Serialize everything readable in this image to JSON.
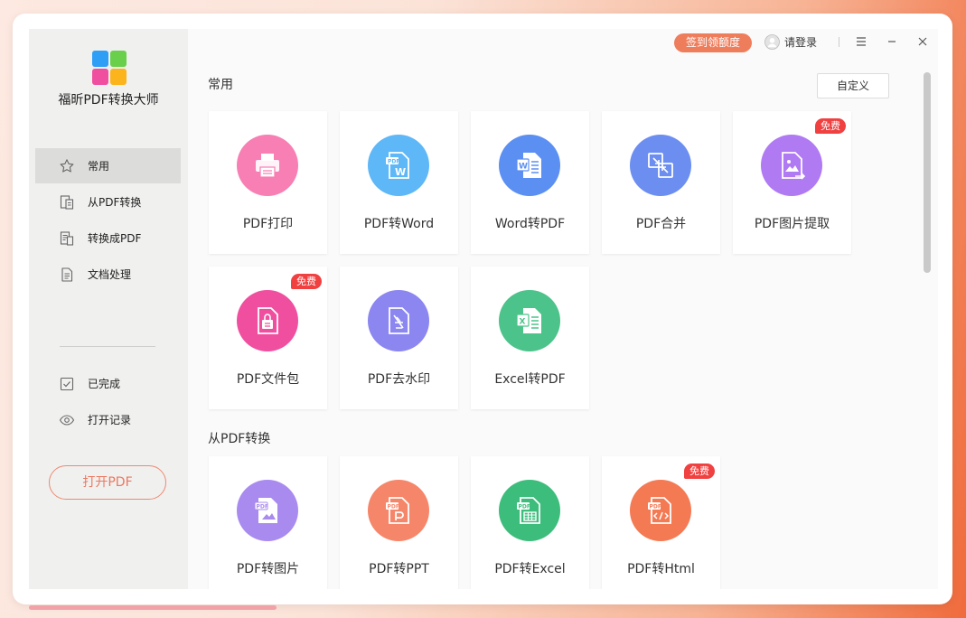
{
  "app": {
    "title": "福昕PDF转换大师"
  },
  "topbar": {
    "checkin_label": "签到领额度",
    "login_label": "请登录"
  },
  "sidebar": {
    "items": [
      {
        "label": "常用",
        "icon": "star-icon",
        "active": true
      },
      {
        "label": "从PDF转换",
        "icon": "doc-convert-from-icon"
      },
      {
        "label": "转换成PDF",
        "icon": "doc-convert-to-icon"
      },
      {
        "label": "文档处理",
        "icon": "document-icon"
      }
    ],
    "bottom_items": [
      {
        "label": "已完成",
        "icon": "check-square-icon"
      },
      {
        "label": "打开记录",
        "icon": "eye-icon"
      }
    ],
    "open_pdf_label": "打开PDF"
  },
  "sections": {
    "common": {
      "title": "常用",
      "customize_label": "自定义",
      "cards": [
        {
          "label": "PDF打印",
          "icon": "printer-icon",
          "color": "#f77fb4"
        },
        {
          "label": "PDF转Word",
          "icon": "pdf-to-word-icon",
          "color": "#5eb7f7"
        },
        {
          "label": "Word转PDF",
          "icon": "word-to-pdf-icon",
          "color": "#5c8ff2"
        },
        {
          "label": "PDF合并",
          "icon": "merge-icon",
          "color": "#6b8ef0"
        },
        {
          "label": "PDF图片提取",
          "icon": "image-extract-icon",
          "color": "#b07af3",
          "badge": "免费"
        },
        {
          "label": "PDF文件包",
          "icon": "file-package-icon",
          "color": "#f04f9f",
          "badge": "免费"
        },
        {
          "label": "PDF去水印",
          "icon": "remove-watermark-icon",
          "color": "#8b86f0"
        },
        {
          "label": "Excel转PDF",
          "icon": "excel-to-pdf-icon",
          "color": "#4cc38a"
        }
      ]
    },
    "from_pdf": {
      "title": "从PDF转换",
      "cards": [
        {
          "label": "PDF转图片",
          "icon": "pdf-to-image-icon",
          "color": "#a98bf0"
        },
        {
          "label": "PDF转PPT",
          "icon": "pdf-to-ppt-icon",
          "color": "#f6866a"
        },
        {
          "label": "PDF转Excel",
          "icon": "pdf-to-excel-icon",
          "color": "#3dbd7c"
        },
        {
          "label": "PDF转Html",
          "icon": "pdf-to-html-icon",
          "color": "#f47a54",
          "badge": "免费"
        }
      ]
    }
  }
}
